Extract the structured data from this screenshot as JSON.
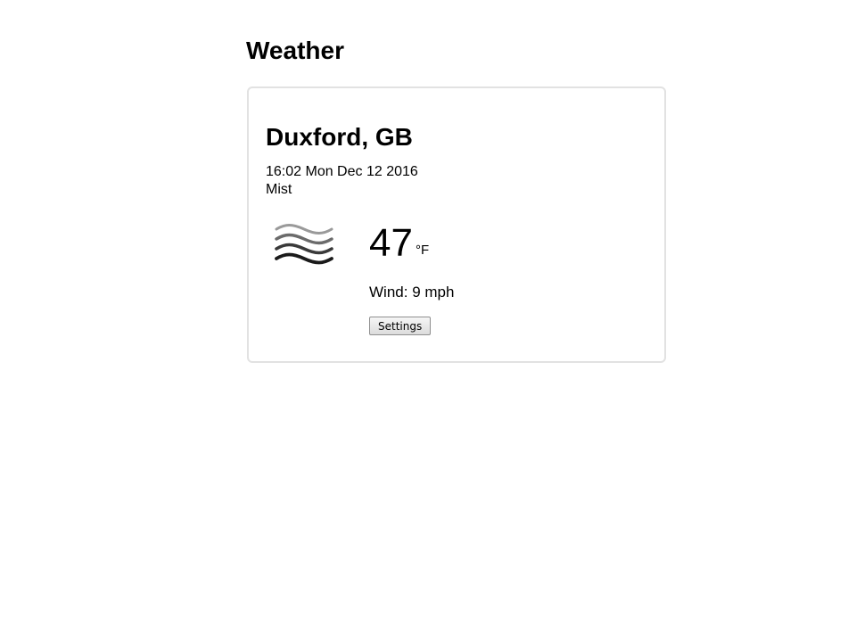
{
  "page": {
    "title": "Weather"
  },
  "card": {
    "location": "Duxford, GB",
    "datetime": "16:02 Mon Dec 12 2016",
    "condition": "Mist",
    "icon": "mist-icon",
    "temperature": "47",
    "temperature_unit": "°F",
    "wind_label": "Wind:",
    "wind_value": "9 mph",
    "settings_label": "Settings"
  }
}
